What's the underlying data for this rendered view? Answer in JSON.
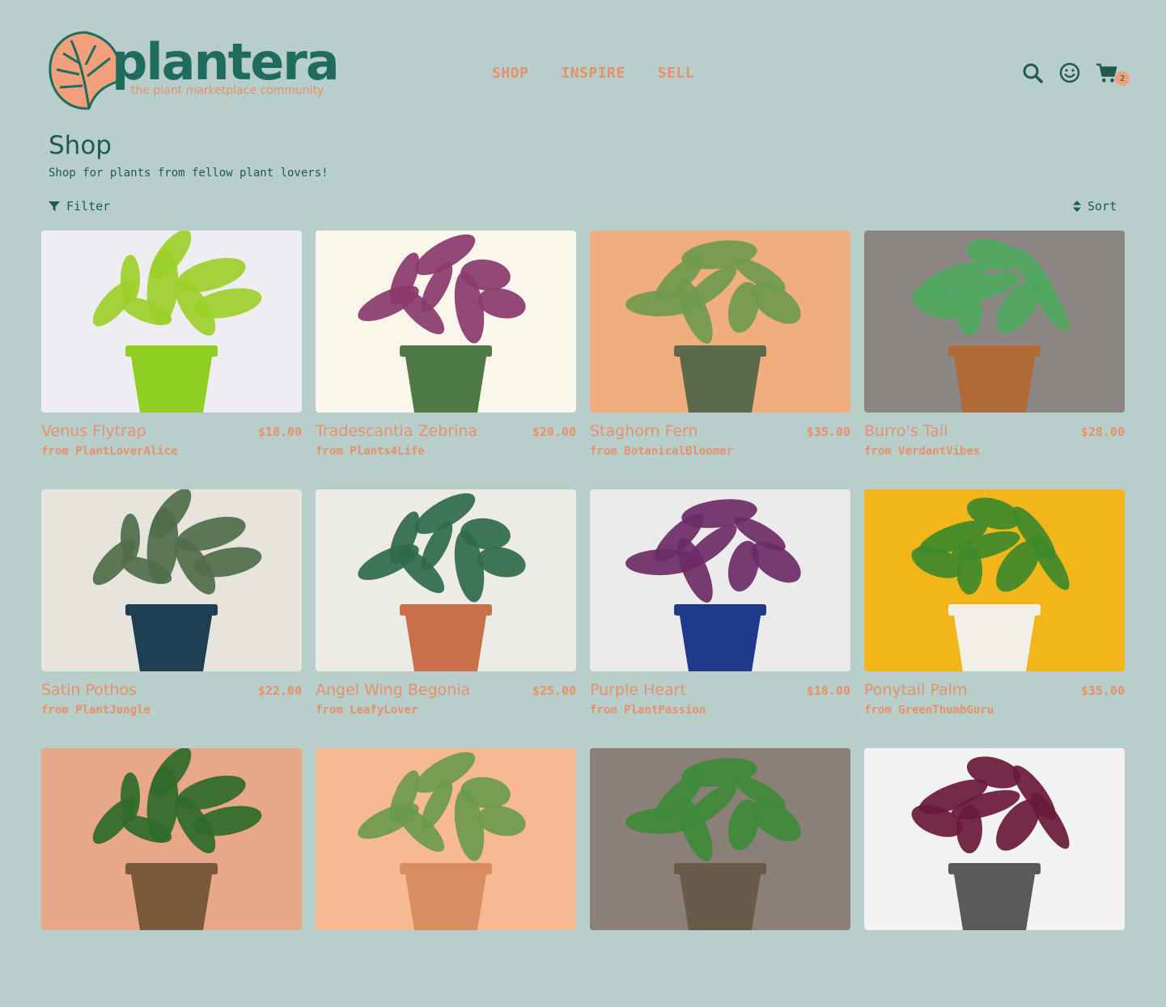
{
  "brand": {
    "name": "plantera",
    "tagline": "the plant marketplace community"
  },
  "nav": [
    {
      "label": "SHOP"
    },
    {
      "label": "INSPIRE"
    },
    {
      "label": "SELL"
    }
  ],
  "header_icons": {
    "search": "search-icon",
    "account": "smiley-icon",
    "cart": "cart-icon",
    "cart_count": "2"
  },
  "page": {
    "title": "Shop",
    "subtitle": "Shop for plants from fellow plant lovers!"
  },
  "toolbar": {
    "filter_label": "Filter",
    "sort_label": "Sort"
  },
  "colors": {
    "background": "#b7cecb",
    "accent": "#e8906a",
    "brand": "#1f6b5d"
  },
  "products": [
    {
      "name": "Venus Flytrap",
      "price": "$18.00",
      "seller": "from PlantLoverAlice",
      "bg": "#eeeef2",
      "leaf": "#9ccf2a",
      "pot": "#8fcf1f"
    },
    {
      "name": "Tradescantia Zebrina",
      "price": "$20.00",
      "seller": "from Plants4Life",
      "bg": "#faf7ea",
      "leaf": "#8a3a6a",
      "pot": "#4d7a46"
    },
    {
      "name": "Staghorn Fern",
      "price": "$35.00",
      "seller": "from BotanicalBloomer",
      "bg": "#f0ae7e",
      "leaf": "#6f9a4d",
      "pot": "#5a6a4a"
    },
    {
      "name": "Burro's Tail",
      "price": "$28.00",
      "seller": "from VerdantVibes",
      "bg": "#8c8684",
      "leaf": "#4fa760",
      "pot": "#b06a38"
    },
    {
      "name": "Satin Pothos",
      "price": "$22.00",
      "seller": "from PlantJungle",
      "bg": "#e7e3dd",
      "leaf": "#4f6e4a",
      "pot": "#1f3f52"
    },
    {
      "name": "Angel Wing Begonia",
      "price": "$25.00",
      "seller": "from LeafyLover",
      "bg": "#ecebe6",
      "leaf": "#2f6a4a",
      "pot": "#c9704a"
    },
    {
      "name": "Purple Heart",
      "price": "$18.00",
      "seller": "from PlantPassion",
      "bg": "#ebebeb",
      "leaf": "#6d2a66",
      "pot": "#1f3a8a"
    },
    {
      "name": "Ponytail Palm",
      "price": "$35.00",
      "seller": "from GreenThumbGuru",
      "bg": "#f2b51a",
      "leaf": "#3e8a2a",
      "pot": "#f2efe8"
    },
    {
      "name": "",
      "price": "",
      "seller": "",
      "bg": "#e9a789",
      "leaf": "#2f6a2a",
      "pot": "#7a5a3a"
    },
    {
      "name": "",
      "price": "",
      "seller": "",
      "bg": "#f7b994",
      "leaf": "#6a9a4a",
      "pot": "#d98e62"
    },
    {
      "name": "",
      "price": "",
      "seller": "",
      "bg": "#8b8078",
      "leaf": "#3f8a3a",
      "pot": "#6a5a4a"
    },
    {
      "name": "",
      "price": "",
      "seller": "",
      "bg": "#f2f2f0",
      "leaf": "#6a1a3a",
      "pot": "#5a5a5a"
    }
  ]
}
